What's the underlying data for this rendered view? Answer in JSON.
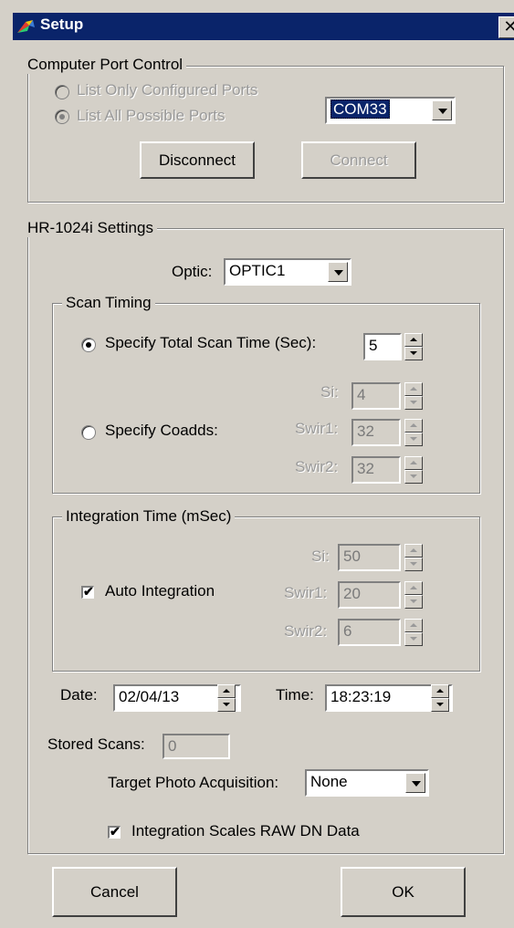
{
  "window": {
    "title": "Setup",
    "close_glyph": "✕"
  },
  "port": {
    "legend": "Computer Port Control",
    "radio_configured": "List Only Configured Ports",
    "radio_all": "List All Possible Ports",
    "com_value": "COM33",
    "disconnect": "Disconnect",
    "connect": "Connect"
  },
  "settings": {
    "legend": "HR-1024i Settings",
    "optic_label": "Optic:",
    "optic_value": "OPTIC1",
    "scan": {
      "legend": "Scan Timing",
      "total_label": "Specify Total Scan Time (Sec):",
      "total_value": "5",
      "coadds_label": "Specify Coadds:",
      "si_label": "Si:",
      "si_value": "4",
      "swir1_label": "Swir1:",
      "swir1_value": "32",
      "swir2_label": "Swir2:",
      "swir2_value": "32"
    },
    "integration": {
      "legend": "Integration Time (mSec)",
      "auto_label": "Auto Integration",
      "si_label": "Si:",
      "si_value": "50",
      "swir1_label": "Swir1:",
      "swir1_value": "20",
      "swir2_label": "Swir2:",
      "swir2_value": "6"
    },
    "date_label": "Date:",
    "date_value": "02/04/13",
    "time_label": "Time:",
    "time_value": "18:23:19",
    "stored_label": "Stored Scans:",
    "stored_value": "0",
    "photo_label": "Target Photo Acquisition:",
    "photo_value": "None",
    "scales_label": "Integration Scales RAW DN Data"
  },
  "buttons": {
    "cancel": "Cancel",
    "ok": "OK"
  },
  "colors": {
    "face": "#d4d0c8",
    "title_bar": "#0a246a",
    "title_text": "#ffffff"
  },
  "icons": {
    "app": "multicolor-logo-icon",
    "check": "✔"
  }
}
